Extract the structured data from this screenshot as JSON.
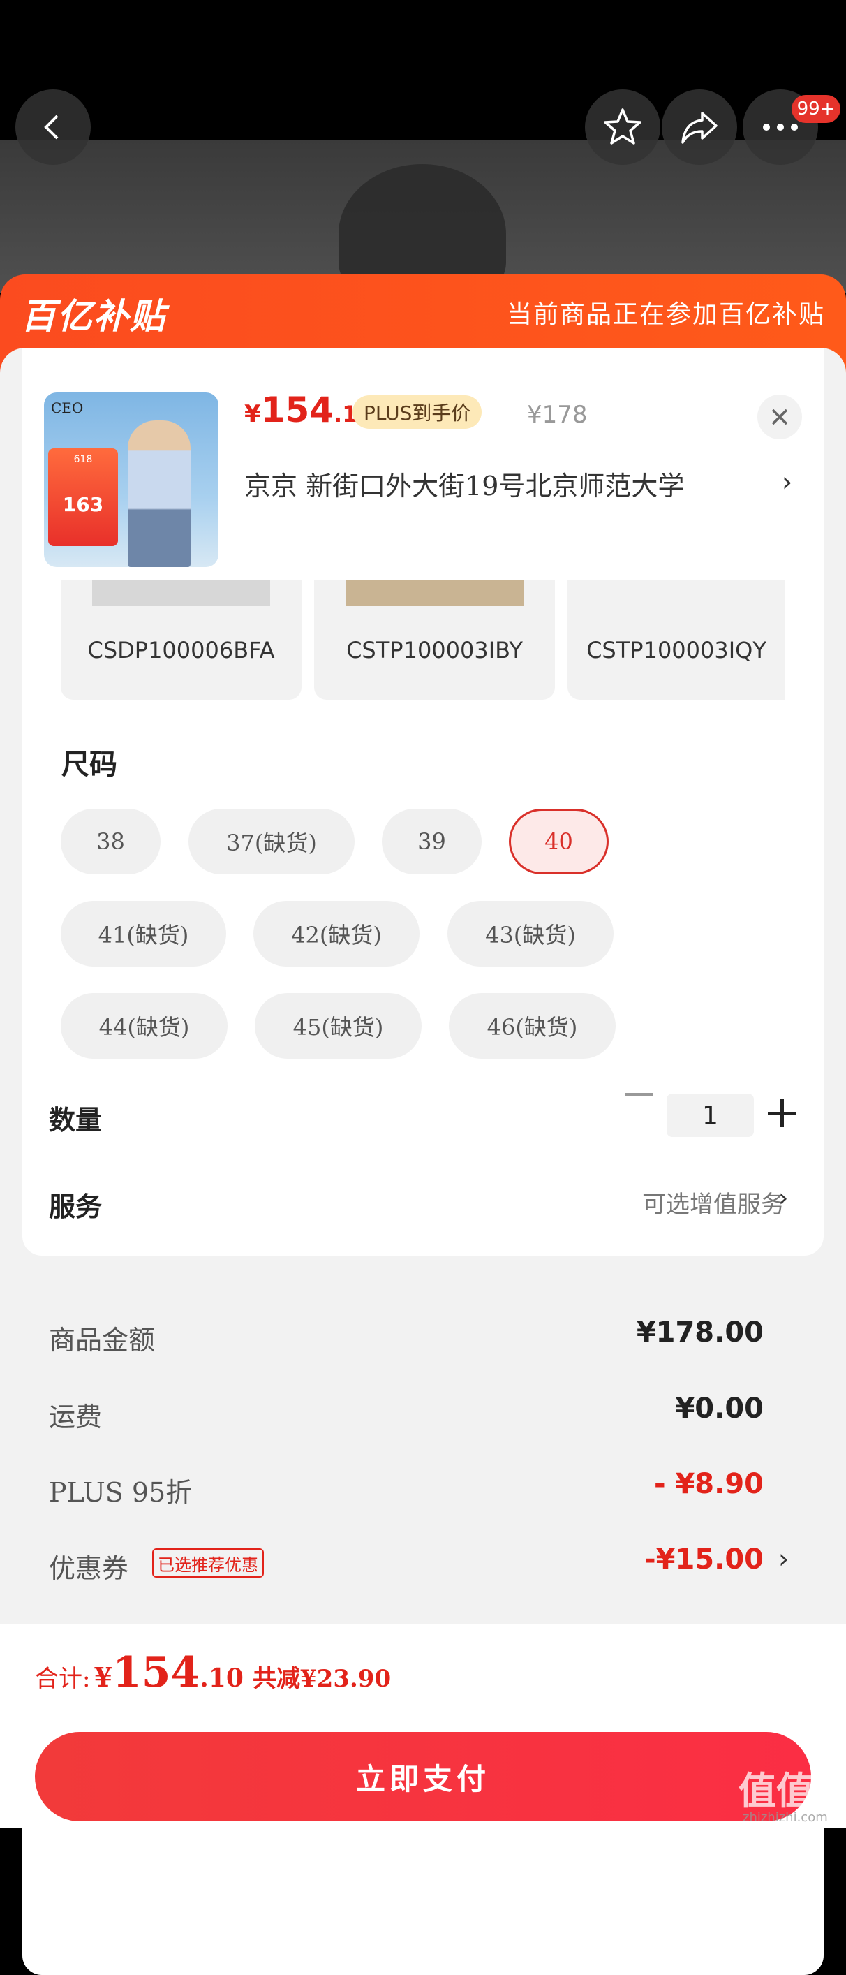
{
  "nav": {
    "badge": "99+"
  },
  "banner": {
    "logo": "百亿补贴",
    "text": "当前商品正在参加百亿补贴"
  },
  "product": {
    "thumb_brand": "CEO",
    "thumb_promo_top": "618",
    "thumb_promo_price": "163",
    "price_currency": "¥",
    "price_int": "154",
    "price_dec": ".1",
    "plus_tag": "PLUS到手价",
    "original_price": "¥178",
    "address": "京京   新街口外大街19号北京师范大学"
  },
  "colors_skus": [
    "CSDP100006BFA",
    "CSTP100003IBY",
    "CSTP100003IQY"
  ],
  "size": {
    "title": "尺码",
    "options": [
      "38",
      "37(缺货)",
      "39",
      "40",
      "41(缺货)",
      "42(缺货)",
      "43(缺货)",
      "44(缺货)",
      "45(缺货)",
      "46(缺货)"
    ],
    "selected": "40"
  },
  "quantity": {
    "label": "数量",
    "value": "1"
  },
  "service": {
    "label": "服务",
    "value": "可选增值服务"
  },
  "fees": {
    "goods_label": "商品金额",
    "goods_value": "¥178.00",
    "shipping_label": "运费",
    "shipping_value": "¥0.00",
    "plus_label": "PLUS 95折",
    "plus_value": "- ¥8.90",
    "coupon_label": "优惠券",
    "coupon_tag": "已选推荐优惠",
    "coupon_value": "-¥15.00"
  },
  "footer": {
    "total_label": "合计:",
    "total_currency": "¥",
    "total_int": "154",
    "total_dec": ".10",
    "save_text": "共减¥23.90",
    "pay_button": "立即支付"
  },
  "watermark": {
    "text": "值值值",
    "sub": "zhizhizhi.com"
  },
  "theme": {
    "accent": "#e2231a",
    "banner": "#fb4b1f"
  }
}
